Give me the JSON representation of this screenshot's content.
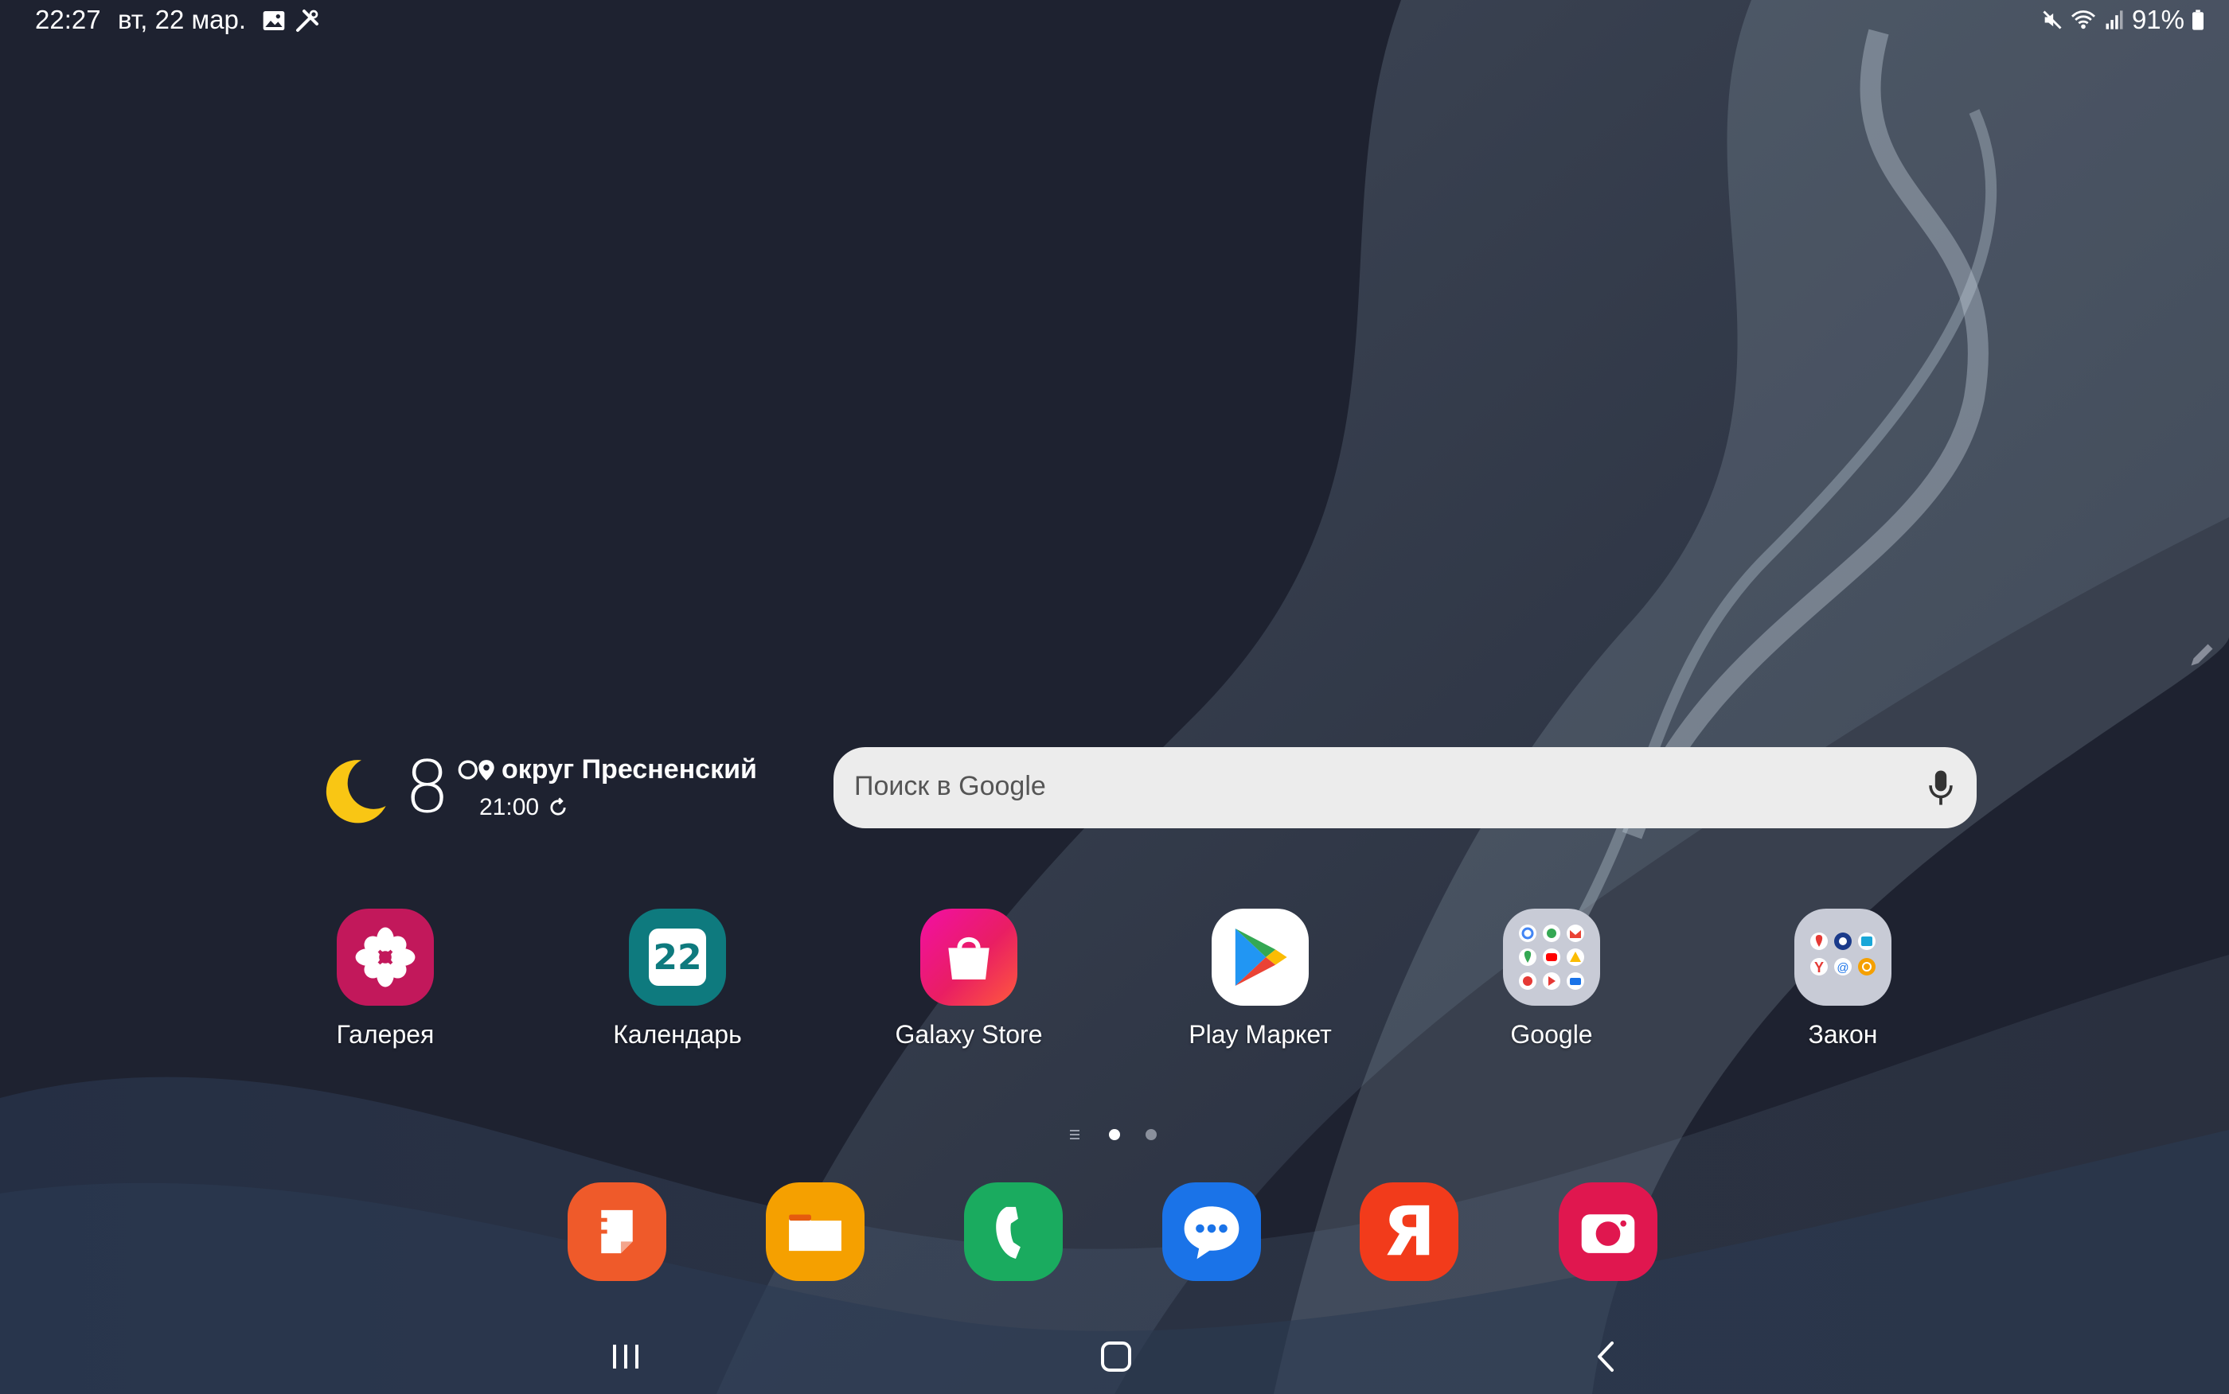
{
  "status_bar": {
    "time": "22:27",
    "date": "вт, 22 мар.",
    "battery": "91%",
    "left_icons": [
      "image-icon",
      "tools-icon"
    ],
    "right_icons": [
      "mute-icon",
      "wifi-icon",
      "signal-icon",
      "battery-icon"
    ]
  },
  "weather": {
    "temperature": "8°",
    "location": "округ Пресненский",
    "updated": "21:00",
    "condition_icon": "moon-icon"
  },
  "search": {
    "placeholder": "Поиск в Google"
  },
  "apps": [
    {
      "label": "Галерея",
      "icon": "gallery-icon",
      "color": "#c2185b"
    },
    {
      "label": "Календарь",
      "icon": "calendar-icon",
      "color": "#0e7a7e",
      "day": "22"
    },
    {
      "label": "Galaxy Store",
      "icon": "galaxy-store-icon",
      "color": "#e91e63"
    },
    {
      "label": "Play Маркет",
      "icon": "play-market-icon",
      "color": "#ffffff"
    },
    {
      "label": "Google",
      "icon": "google-folder-icon",
      "color": "#c8cbd6"
    },
    {
      "label": "Закон",
      "icon": "zakon-folder-icon",
      "color": "#c8cbd6"
    }
  ],
  "dock": [
    {
      "name": "notes",
      "icon": "notes-icon",
      "color": "#ef5a2a"
    },
    {
      "name": "files",
      "icon": "my-files-icon",
      "color": "#f5a000"
    },
    {
      "name": "phone",
      "icon": "phone-icon",
      "color": "#1aab5f"
    },
    {
      "name": "messages",
      "icon": "messages-icon",
      "color": "#1a73e8"
    },
    {
      "name": "yandex",
      "icon": "yandex-icon",
      "color": "#f23b1b",
      "glyph": "Я"
    },
    {
      "name": "camera",
      "icon": "camera-icon",
      "color": "#e0174f"
    }
  ],
  "page_indicator": {
    "pages": 2,
    "current": 1
  },
  "navigation": [
    "recents-icon",
    "home-icon",
    "back-icon"
  ]
}
